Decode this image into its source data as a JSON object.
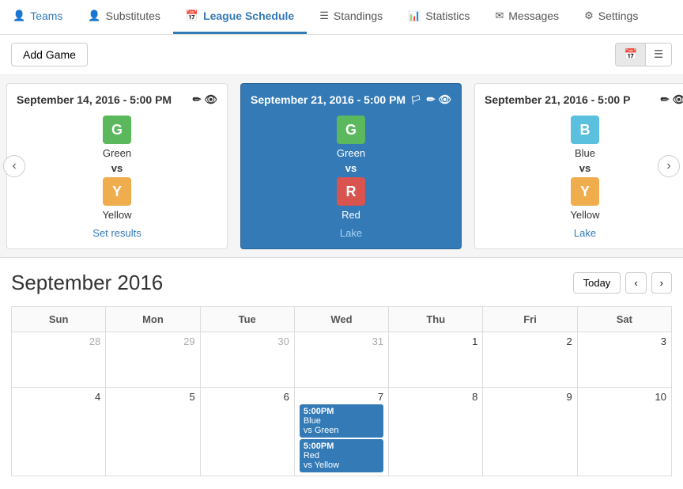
{
  "nav": {
    "items": [
      {
        "id": "teams",
        "label": "Teams",
        "icon": "👤",
        "active": false
      },
      {
        "id": "substitutes",
        "label": "Substitutes",
        "icon": "👤",
        "active": false
      },
      {
        "id": "league-schedule",
        "label": "League Schedule",
        "icon": "📅",
        "active": true
      },
      {
        "id": "standings",
        "label": "Standings",
        "icon": "☰",
        "active": false
      },
      {
        "id": "statistics",
        "label": "Statistics",
        "icon": "📊",
        "active": false
      },
      {
        "id": "messages",
        "label": "Messages",
        "icon": "✉",
        "active": false
      },
      {
        "id": "settings",
        "label": "Settings",
        "icon": "⚙",
        "active": false
      }
    ]
  },
  "toolbar": {
    "add_game_label": "Add Game"
  },
  "carousel": {
    "cards": [
      {
        "id": "card1",
        "date": "September 14, 2016 - 5:00 PM",
        "active": false,
        "team1": {
          "letter": "G",
          "name": "Green",
          "badge": "badge-green"
        },
        "team2": {
          "letter": "Y",
          "name": "Yellow",
          "badge": "badge-yellow"
        },
        "link": "Set results"
      },
      {
        "id": "card2",
        "date": "September 21, 2016 - 5:00 PM",
        "active": true,
        "team1": {
          "letter": "G",
          "name": "Green",
          "badge": "badge-green"
        },
        "team2": {
          "letter": "R",
          "name": "Red",
          "badge": "badge-red"
        },
        "link": "Lake"
      },
      {
        "id": "card3",
        "date": "September 21, 2016 - 5:00 P",
        "active": false,
        "team1": {
          "letter": "B",
          "name": "Blue",
          "badge": "badge-blue"
        },
        "team2": {
          "letter": "Y",
          "name": "Yellow",
          "badge": "badge-yellow"
        },
        "link": "Lake"
      }
    ]
  },
  "calendar": {
    "title": "September 2016",
    "today_label": "Today",
    "days_of_week": [
      "Sun",
      "Mon",
      "Tue",
      "Wed",
      "Thu",
      "Fri",
      "Sat"
    ],
    "weeks": [
      [
        {
          "day": "28",
          "current": false,
          "events": []
        },
        {
          "day": "29",
          "current": false,
          "events": []
        },
        {
          "day": "30",
          "current": false,
          "events": []
        },
        {
          "day": "31",
          "current": false,
          "events": []
        },
        {
          "day": "1",
          "current": true,
          "events": []
        },
        {
          "day": "2",
          "current": true,
          "events": []
        },
        {
          "day": "3",
          "current": true,
          "events": []
        }
      ],
      [
        {
          "day": "4",
          "current": true,
          "events": []
        },
        {
          "day": "5",
          "current": true,
          "events": []
        },
        {
          "day": "6",
          "current": true,
          "events": []
        },
        {
          "day": "7",
          "current": true,
          "events": [
            {
              "time": "5:00PM",
              "line1": "Blue",
              "line2": "vs Green"
            },
            {
              "time": "5:00PM",
              "line1": "Red",
              "line2": "vs Yellow"
            }
          ]
        },
        {
          "day": "8",
          "current": true,
          "events": []
        },
        {
          "day": "9",
          "current": true,
          "events": []
        },
        {
          "day": "10",
          "current": true,
          "events": []
        }
      ]
    ]
  }
}
